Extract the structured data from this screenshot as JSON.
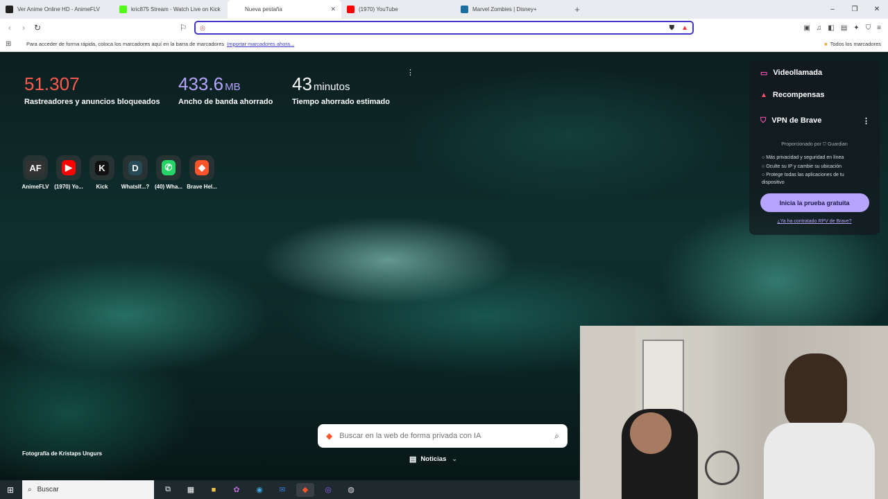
{
  "tabs": [
    {
      "title": "Ver Anime Online HD - AnimeFLV",
      "color": "#222"
    },
    {
      "title": "kric875 Stream - Watch Live on Kick",
      "color": "#53fc18"
    },
    {
      "title": "Nueva pestaña",
      "color": "#fff",
      "active": true
    },
    {
      "title": "(1970) YouTube",
      "color": "#ff0000"
    },
    {
      "title": "Marvel Zombies | Disney+",
      "color": "#1a6fa0"
    }
  ],
  "urlbar": {
    "value": ""
  },
  "bookmarks": {
    "hint": "Para acceder de forma rápida, coloca los marcadores aquí en la barra de marcadores",
    "import_link": "Importar marcadores ahora...",
    "all": "Todos los marcadores"
  },
  "stats": [
    {
      "value": "51.307",
      "unit": "",
      "label": "Rastreadores y anuncios bloqueados",
      "color": "#ff5a4e"
    },
    {
      "value": "433.6",
      "unit": "MB",
      "label": "Ancho de banda ahorrado",
      "color": "#b6a4ff"
    },
    {
      "value": "43",
      "unit": "minutos",
      "label": "Tiempo ahorrado estimado",
      "color": "#ffffff"
    }
  ],
  "tiles": [
    {
      "name": "AnimeFLV",
      "glyph": "AF",
      "bg": "#333"
    },
    {
      "name": "(1970) Yo...",
      "glyph": "▶",
      "bg": "#ff0000"
    },
    {
      "name": "Kick",
      "glyph": "K",
      "bg": "#111"
    },
    {
      "name": "WhatsIf...?",
      "glyph": "D",
      "bg": "#264b57"
    },
    {
      "name": "(40) Wha...",
      "glyph": "✆",
      "bg": "#25d366"
    },
    {
      "name": "Brave Hel...",
      "glyph": "◆",
      "bg": "#fb542b"
    }
  ],
  "panel": {
    "videocall": "Videollamada",
    "rewards": "Recompensas",
    "vpn": "VPN de Brave",
    "powered": "Proporcionado por",
    "guardian": "Guardian",
    "features": [
      "Más privacidad y seguridad en línea",
      "Oculte su IP y cambie su ubicación",
      "Protege todas las aplicaciones de tu dispositivo"
    ],
    "trial_button": "Inicia la prueba gratuita",
    "already_link": "¿Ya ha contratado RPV de Brave?"
  },
  "search": {
    "placeholder": "Buscar en la web de forma privada con IA"
  },
  "news": {
    "label": "Noticias"
  },
  "photo_credit": "Fotografía de Kristaps Ungurs",
  "taskbar": {
    "search": "Buscar"
  }
}
